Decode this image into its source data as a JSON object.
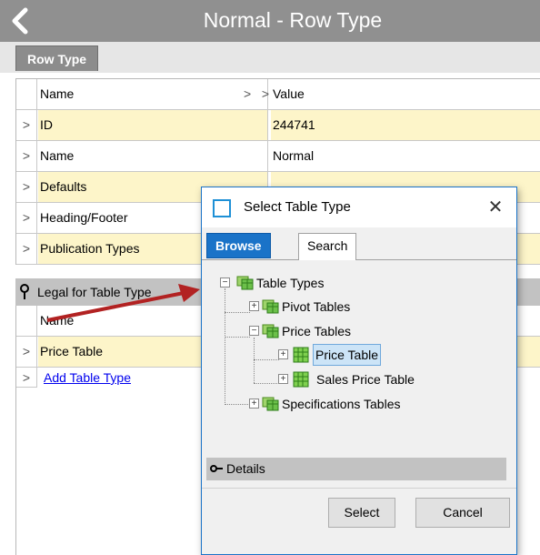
{
  "window": {
    "title": "Normal - Row Type"
  },
  "tabs": {
    "row_type": "Row Type"
  },
  "grid": {
    "headers": {
      "name": "Name",
      "value": "Value"
    },
    "rows": [
      {
        "name": "ID",
        "value": "244741"
      },
      {
        "name": "Name",
        "value": "Normal"
      },
      {
        "name": "Defaults",
        "value": ""
      },
      {
        "name": "Heading/Footer",
        "value": ""
      },
      {
        "name": "Publication Types",
        "value": ""
      }
    ]
  },
  "legal": {
    "title": "Legal for Table Type",
    "header": "Name",
    "items": [
      "Price Table"
    ],
    "add_link": "Add Table Type"
  },
  "dialog": {
    "title": "Select Table Type",
    "tabs": {
      "browse": "Browse",
      "search": "Search"
    },
    "tree": {
      "root": "Table Types",
      "pivot": "Pivot Tables",
      "price": "Price Tables",
      "price_table": "Price Table",
      "sales_price_table": "Sales Price Table",
      "specs": "Specifications Tables"
    },
    "details": "Details",
    "buttons": {
      "select": "Select",
      "cancel": "Cancel"
    }
  },
  "colors": {
    "accent": "#1a73c8",
    "highlight_row": "#fdf5c9",
    "titlebar": "#909090",
    "arrow": "#b22222"
  }
}
